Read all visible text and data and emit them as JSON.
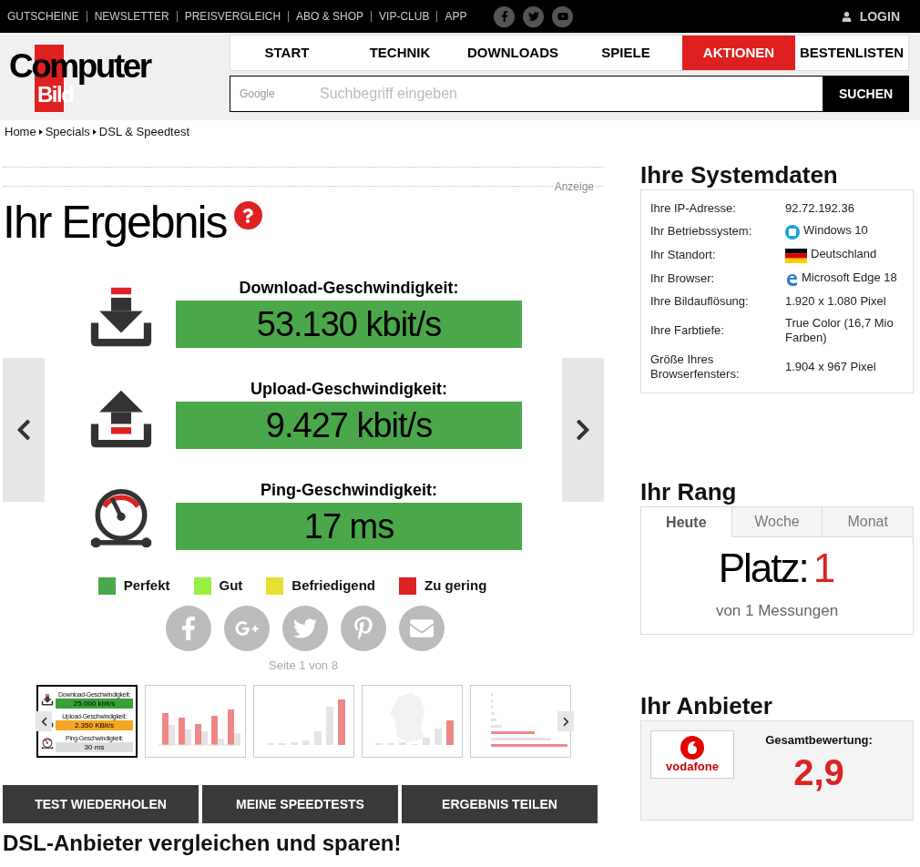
{
  "top_links": [
    "GUTSCHEINE",
    "NEWSLETTER",
    "PREISVERGLEICH",
    "ABO & SHOP",
    "VIP-CLUB",
    "APP"
  ],
  "login": "LOGIN",
  "logo": {
    "line1": "Computer",
    "line2": "Bild"
  },
  "nav": [
    {
      "label": "START",
      "selected": false
    },
    {
      "label": "TECHNIK",
      "selected": false
    },
    {
      "label": "DOWNLOADS",
      "selected": false
    },
    {
      "label": "SPIELE",
      "selected": false
    },
    {
      "label": "AKTIONEN",
      "selected": true
    },
    {
      "label": "BESTENLISTEN",
      "selected": false
    }
  ],
  "search": {
    "provider": "Google",
    "placeholder": "Suchbegriff eingeben",
    "button": "SUCHEN"
  },
  "breadcrumb": [
    "Home",
    "Specials",
    "DSL & Speedtest"
  ],
  "ad_label": "Anzeige",
  "result": {
    "title": "Ihr Ergebnis",
    "metrics": [
      {
        "kind": "download",
        "label": "Download-Geschwindigkeit:",
        "value": "53.130 kbit/s",
        "color": "#4aa84a"
      },
      {
        "kind": "upload",
        "label": "Upload-Geschwindigkeit:",
        "value": "9.427 kbit/s",
        "color": "#4aa84a"
      },
      {
        "kind": "ping",
        "label": "Ping-Geschwindigkeit:",
        "value": "17 ms",
        "color": "#4aa84a"
      }
    ],
    "legend": [
      {
        "label": "Perfekt",
        "color": "#4aa84a"
      },
      {
        "label": "Gut",
        "color": "#99ee44"
      },
      {
        "label": "Befriedigend",
        "color": "#e8e030"
      },
      {
        "label": "Zu gering",
        "color": "#dd2222"
      }
    ],
    "pagination": "Seite 1 von 8",
    "thumbnails": [
      {
        "kind": "result",
        "selected": true,
        "items": [
          {
            "kind": "download",
            "label": "Download-Geschwindigkeit:",
            "value": "25.000 kbit/s",
            "color": "#3aa03a"
          },
          {
            "kind": "upload",
            "label": "Upload-Geschwindigkeit:",
            "value": "2.350 KBit/s",
            "color": "#f5a623"
          },
          {
            "kind": "ping",
            "label": "Ping-Geschwindigkeit:",
            "value": "30 ms",
            "color": "#dddddd"
          }
        ]
      },
      {
        "kind": "bars",
        "selected": false
      },
      {
        "kind": "columns",
        "selected": false
      },
      {
        "kind": "map",
        "selected": false
      },
      {
        "kind": "hbars",
        "selected": false
      }
    ]
  },
  "actions": [
    "TEST WIEDERHOLEN",
    "MEINE SPEEDTESTS",
    "ERGEBNIS TEILEN"
  ],
  "footer_heading": "DSL-Anbieter vergleichen und sparen!",
  "system": {
    "title": "Ihre Systemdaten",
    "rows": [
      {
        "label": "Ihre IP-Adresse:",
        "value": "92.72.192.36",
        "kind": "plain"
      },
      {
        "label": "Ihr Betriebssystem:",
        "value": "Windows 10",
        "kind": "windows"
      },
      {
        "label": "Ihr Standort:",
        "value": "Deutschland",
        "kind": "flag"
      },
      {
        "label": "Ihr Browser:",
        "value": "Microsoft Edge 18",
        "kind": "edge"
      },
      {
        "label": "Ihre Bildauflösung:",
        "value": "1.920 x 1.080 Pixel",
        "kind": "plain"
      },
      {
        "label": "Ihre Farbtiefe:",
        "value": "True Color (16,7 Mio Farben)",
        "kind": "plain"
      },
      {
        "label": "Größe Ihres Browserfensters:",
        "value": "1.904 x 967 Pixel",
        "kind": "plain"
      }
    ]
  },
  "rank": {
    "title": "Ihr Rang",
    "tabs": [
      {
        "label": "Heute",
        "selected": true
      },
      {
        "label": "Woche",
        "selected": false
      },
      {
        "label": "Monat",
        "selected": false
      }
    ],
    "label": "Platz:",
    "value": "1",
    "note": "von 1 Messungen"
  },
  "provider": {
    "title": "Ihr Anbieter",
    "logo": "vodafone",
    "rating_label": "Gesamtbewertung:",
    "rating": "2,9"
  }
}
